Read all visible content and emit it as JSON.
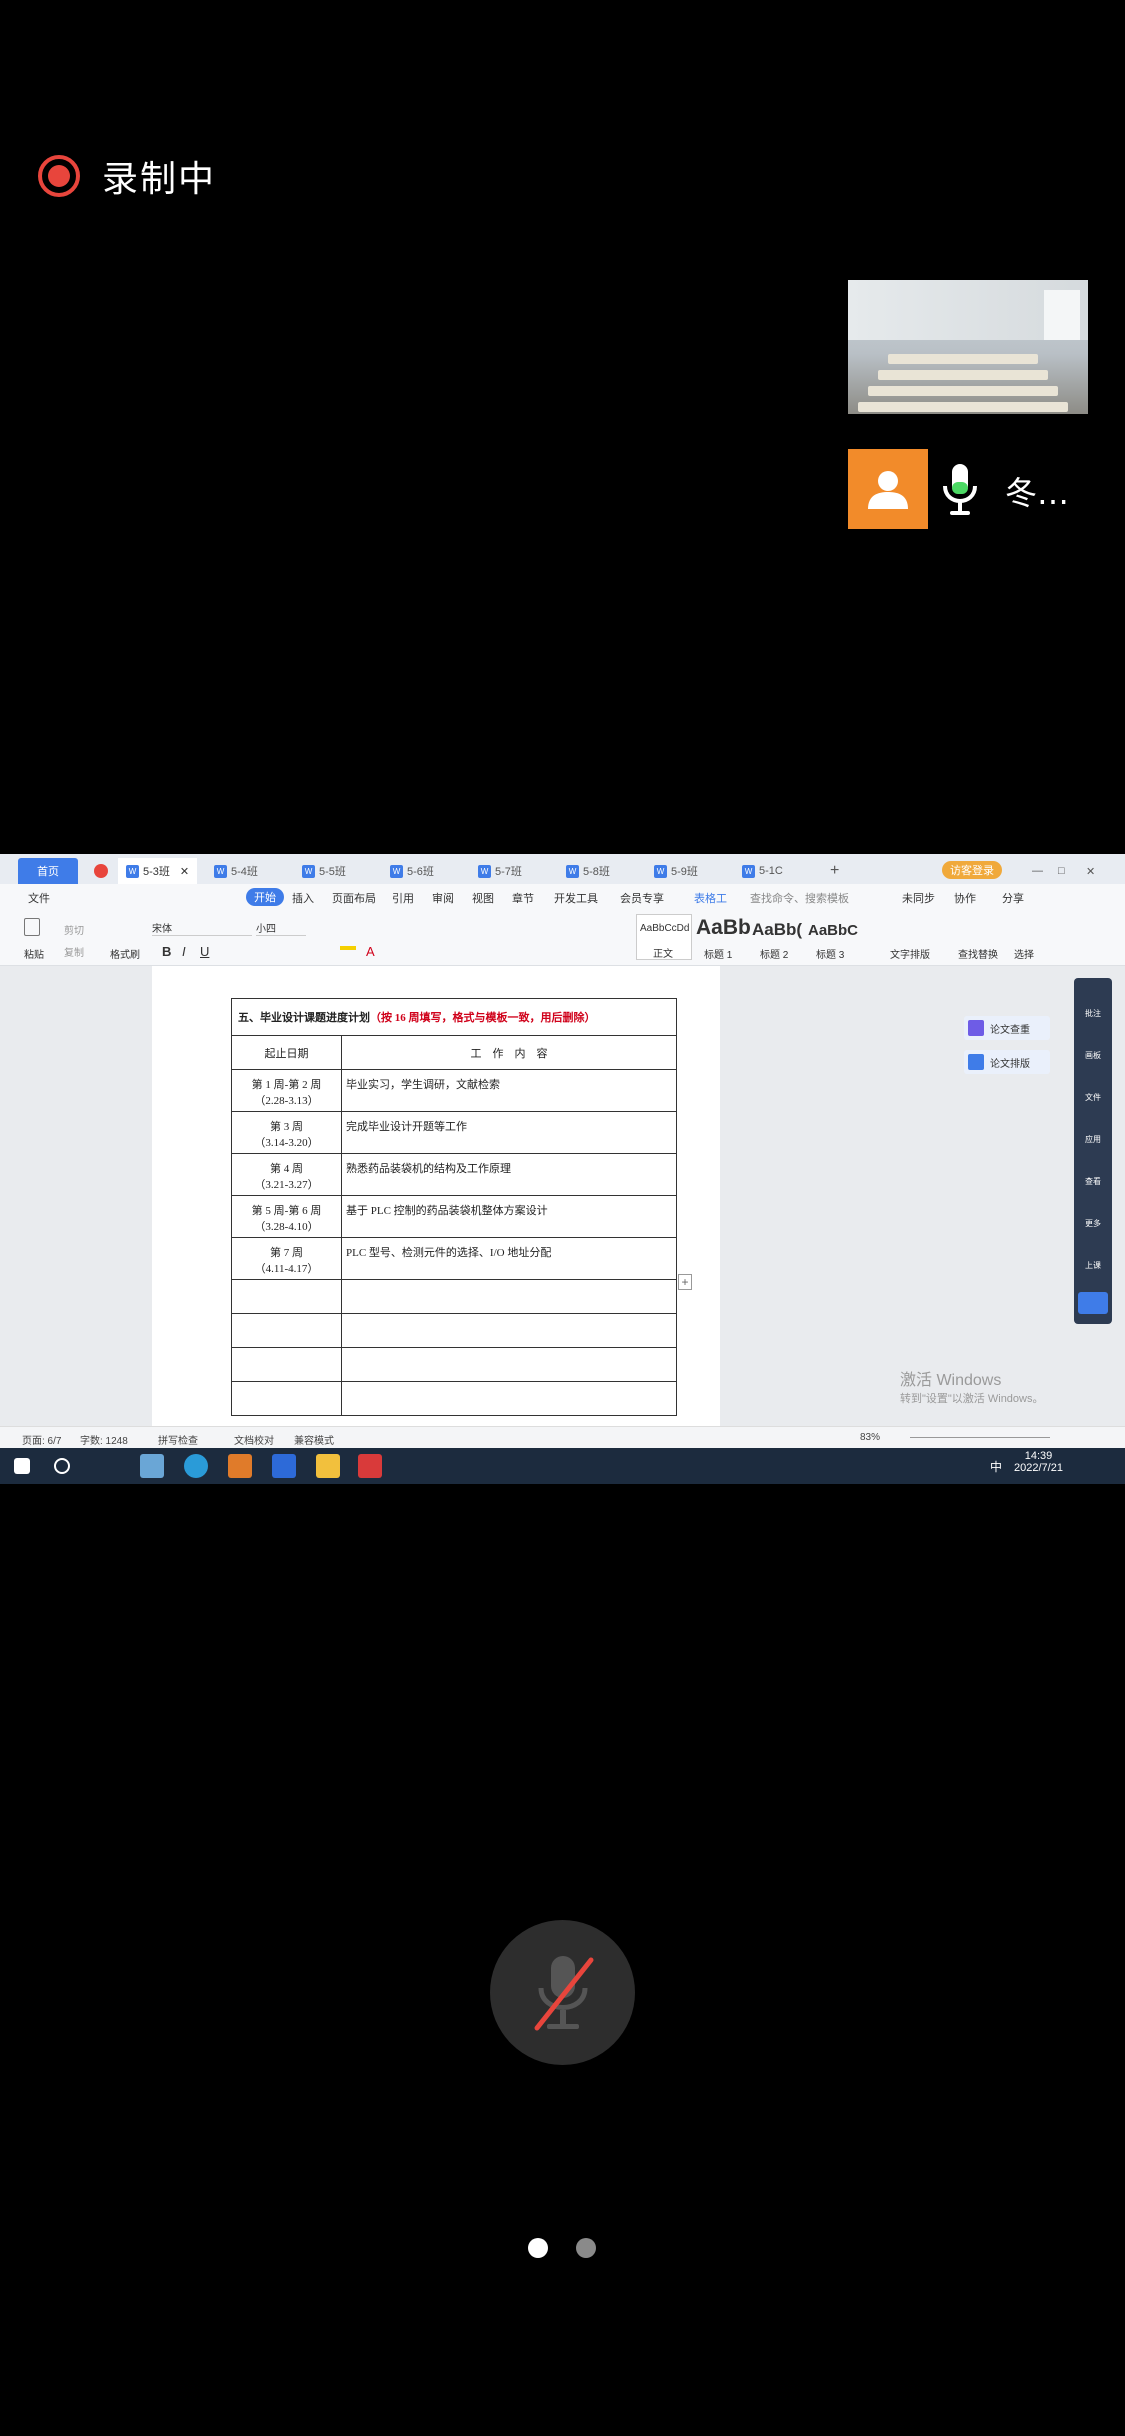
{
  "recording": {
    "label": "录制中"
  },
  "participant": {
    "name": "冬…"
  },
  "window": {
    "tabs": {
      "home": "首页",
      "docs": [
        "5-3班",
        "5-4班",
        "5-5班",
        "5-6班",
        "5-7班",
        "5-8班",
        "5-9班",
        "5-1C"
      ],
      "login": "访客登录"
    },
    "menu": {
      "file": "文件",
      "items": [
        "开始",
        "插入",
        "页面布局",
        "引用",
        "审阅",
        "视图",
        "章节",
        "开发工具",
        "会员专享",
        "表格工"
      ],
      "search_placeholder": "查找命令、搜索模板",
      "sync": "未同步",
      "collab": "协作",
      "share": "分享"
    },
    "ribbon": {
      "paste": "粘贴",
      "cut": "剪切",
      "copy": "复制",
      "format_painter": "格式刷",
      "font_name": "宋体",
      "font_size": "小四",
      "style_preview": "AaBbCcDd",
      "styles": [
        "正文",
        "标题 1",
        "标题 2",
        "标题 3"
      ],
      "style_samples": [
        "AaBb",
        "AaBb(",
        "AaBbC"
      ],
      "text_layout": "文字排版",
      "find_replace": "查找替换",
      "select": "选择"
    },
    "doc": {
      "heading_black": "五、毕业设计课题进度计划",
      "heading_red": "（按 16 周填写，格式与模板一致，用后删除）",
      "col_date": "起止日期",
      "col_content": "工　作　内　容",
      "rows": [
        {
          "date1": "第 1 周-第 2 周",
          "date2": "（2.28-3.13）",
          "content": "毕业实习，学生调研，文献检索"
        },
        {
          "date1": "第 3 周",
          "date2": "（3.14-3.20）",
          "content": "完成毕业设计开题等工作"
        },
        {
          "date1": "第 4 周",
          "date2": "（3.21-3.27）",
          "content": "熟悉药品装袋机的结构及工作原理"
        },
        {
          "date1": "第 5 周-第 6 周",
          "date2": "（3.28-4.10）",
          "content": "基于 PLC 控制的药品装袋机整体方案设计"
        },
        {
          "date1": "第 7 周",
          "date2": "（4.11-4.17）",
          "content": "PLC 型号、检测元件的选择、I/O 地址分配"
        }
      ]
    },
    "side_buttons": [
      "论文查重",
      "论文排版"
    ],
    "panel_items": [
      "批注",
      "画板",
      "文件",
      "应用",
      "查看",
      "更多",
      "上课"
    ],
    "watermark": {
      "title": "激活 Windows",
      "sub": "转到\"设置\"以激活 Windows。"
    },
    "status": {
      "page": "页面: 6/7",
      "words": "字数: 1248",
      "spell": "拼写检查",
      "proof": "文档校对",
      "compat": "兼容模式",
      "zoom": "83%"
    },
    "taskbar": {
      "ime": "中",
      "time": "14:39",
      "date": "2022/7/21"
    }
  },
  "colors": {
    "record": "#e8453c",
    "avatar": "#f28b2a",
    "mic_green": "#4cd964",
    "wps_blue": "#3f7ce8",
    "heading_red": "#d0021b"
  },
  "pager": {
    "pages": 2,
    "current": 1
  }
}
